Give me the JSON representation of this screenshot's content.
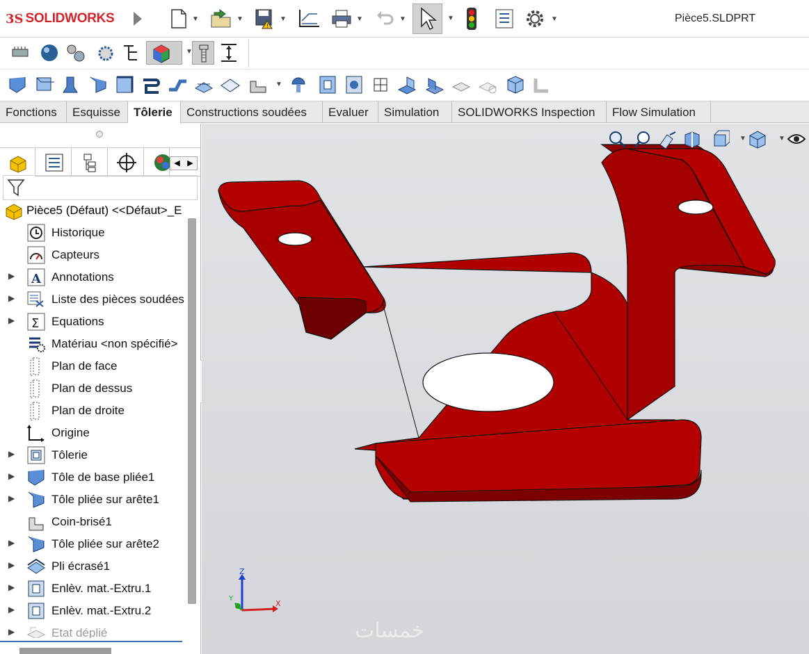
{
  "app": {
    "logo_prefix": "3S",
    "logo_text": "SOLIDWORKS",
    "file_name": "Pièce5.SLDPRT"
  },
  "tabs": [
    {
      "label": "Fonctions",
      "active": false
    },
    {
      "label": "Esquisse",
      "active": false
    },
    {
      "label": "Tôlerie",
      "active": true
    },
    {
      "label": "Constructions soudées",
      "active": false
    },
    {
      "label": "Evaluer",
      "active": false
    },
    {
      "label": "Simulation",
      "active": false
    },
    {
      "label": "SOLIDWORKS Inspection",
      "active": false
    },
    {
      "label": "Flow Simulation",
      "active": false
    }
  ],
  "tree": {
    "root": "Pièce5 (Défaut) <<Défaut>_E",
    "items": [
      {
        "label": "Historique",
        "icon": "history-icon",
        "expandable": false
      },
      {
        "label": "Capteurs",
        "icon": "sensors-icon",
        "expandable": false
      },
      {
        "label": "Annotations",
        "icon": "annotations-icon",
        "expandable": true
      },
      {
        "label": "Liste des pièces soudées",
        "icon": "cut-list-icon",
        "expandable": true
      },
      {
        "label": "Equations",
        "icon": "equations-icon",
        "expandable": true
      },
      {
        "label": "Matériau <non spécifié>",
        "icon": "material-icon",
        "expandable": false
      },
      {
        "label": "Plan de face",
        "icon": "plane-icon",
        "expandable": false
      },
      {
        "label": "Plan de dessus",
        "icon": "plane-icon",
        "expandable": false
      },
      {
        "label": "Plan de droite",
        "icon": "plane-icon",
        "expandable": false
      },
      {
        "label": "Origine",
        "icon": "origin-icon",
        "expandable": false
      },
      {
        "label": "Tôlerie",
        "icon": "sheet-metal-icon",
        "expandable": true
      },
      {
        "label": "Tôle de base pliée1",
        "icon": "base-flange-icon",
        "expandable": true
      },
      {
        "label": "Tôle pliée sur arête1",
        "icon": "edge-flange-icon",
        "expandable": true
      },
      {
        "label": "Coin-brisé1",
        "icon": "break-corner-icon",
        "expandable": false
      },
      {
        "label": "Tôle pliée sur arête2",
        "icon": "edge-flange-icon",
        "expandable": true
      },
      {
        "label": "Pli écrasé1",
        "icon": "hem-icon",
        "expandable": true
      },
      {
        "label": "Enlèv. mat.-Extru.1",
        "icon": "extruded-cut-icon",
        "expandable": true
      },
      {
        "label": "Enlèv. mat.-Extru.2",
        "icon": "extruded-cut-icon",
        "expandable": true
      },
      {
        "label": "Etat déplié",
        "icon": "flat-pattern-icon",
        "expandable": true,
        "suppressed": true
      }
    ]
  },
  "triad": {
    "x": "X",
    "y": "Y",
    "z": "Z"
  },
  "colors": {
    "model": "#b00000",
    "model_shadow": "#7a0000",
    "brand": "#d3242a",
    "viewport": "#dcdee2"
  },
  "watermark": "خمسات"
}
